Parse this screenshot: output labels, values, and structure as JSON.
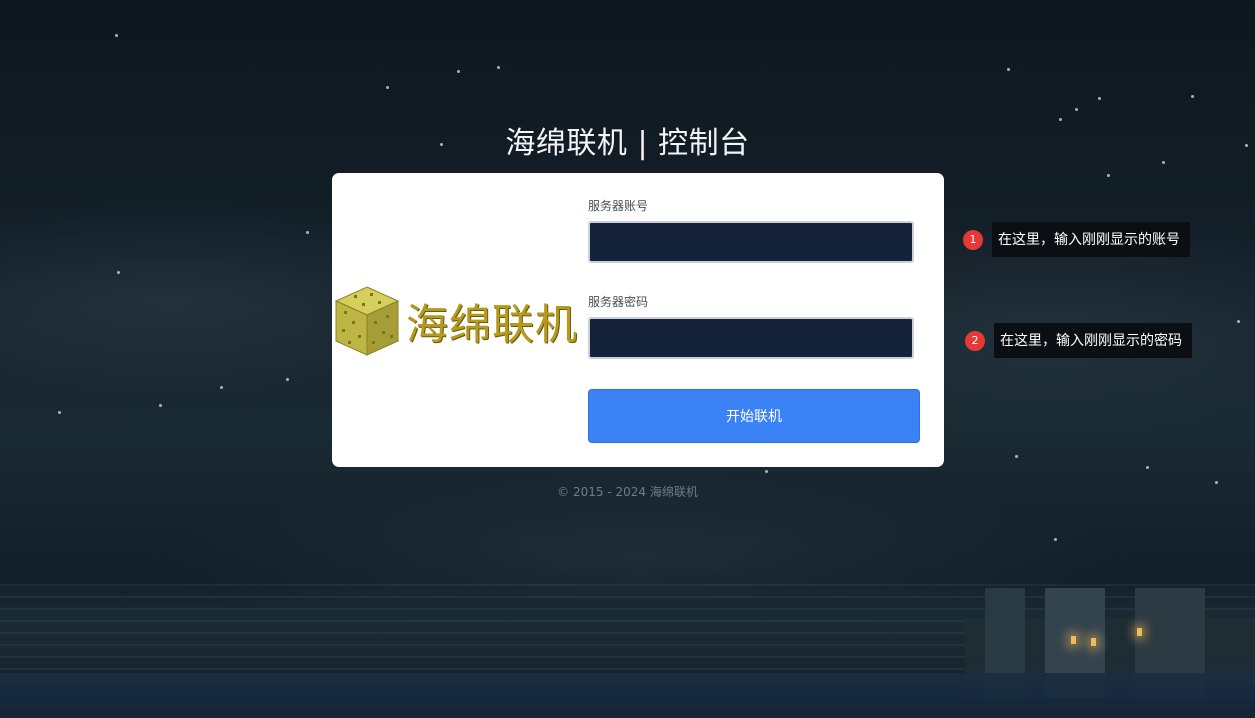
{
  "title": "海绵联机 | 控制台",
  "logo": {
    "text": "海绵联机"
  },
  "form": {
    "account_label": "服务器账号",
    "account_value": "",
    "password_label": "服务器密码",
    "password_value": "",
    "submit_label": "开始联机"
  },
  "footer": "© 2015 - 2024 海绵联机",
  "hints": [
    {
      "number": "1",
      "text": "在这里，输入刚刚显示的账号"
    },
    {
      "number": "2",
      "text": "在这里，输入刚刚显示的密码"
    }
  ],
  "colors": {
    "accent": "#3b82f6",
    "input_bg": "#14233a",
    "badge": "#e53935",
    "logo_text": "#b59a1e"
  }
}
